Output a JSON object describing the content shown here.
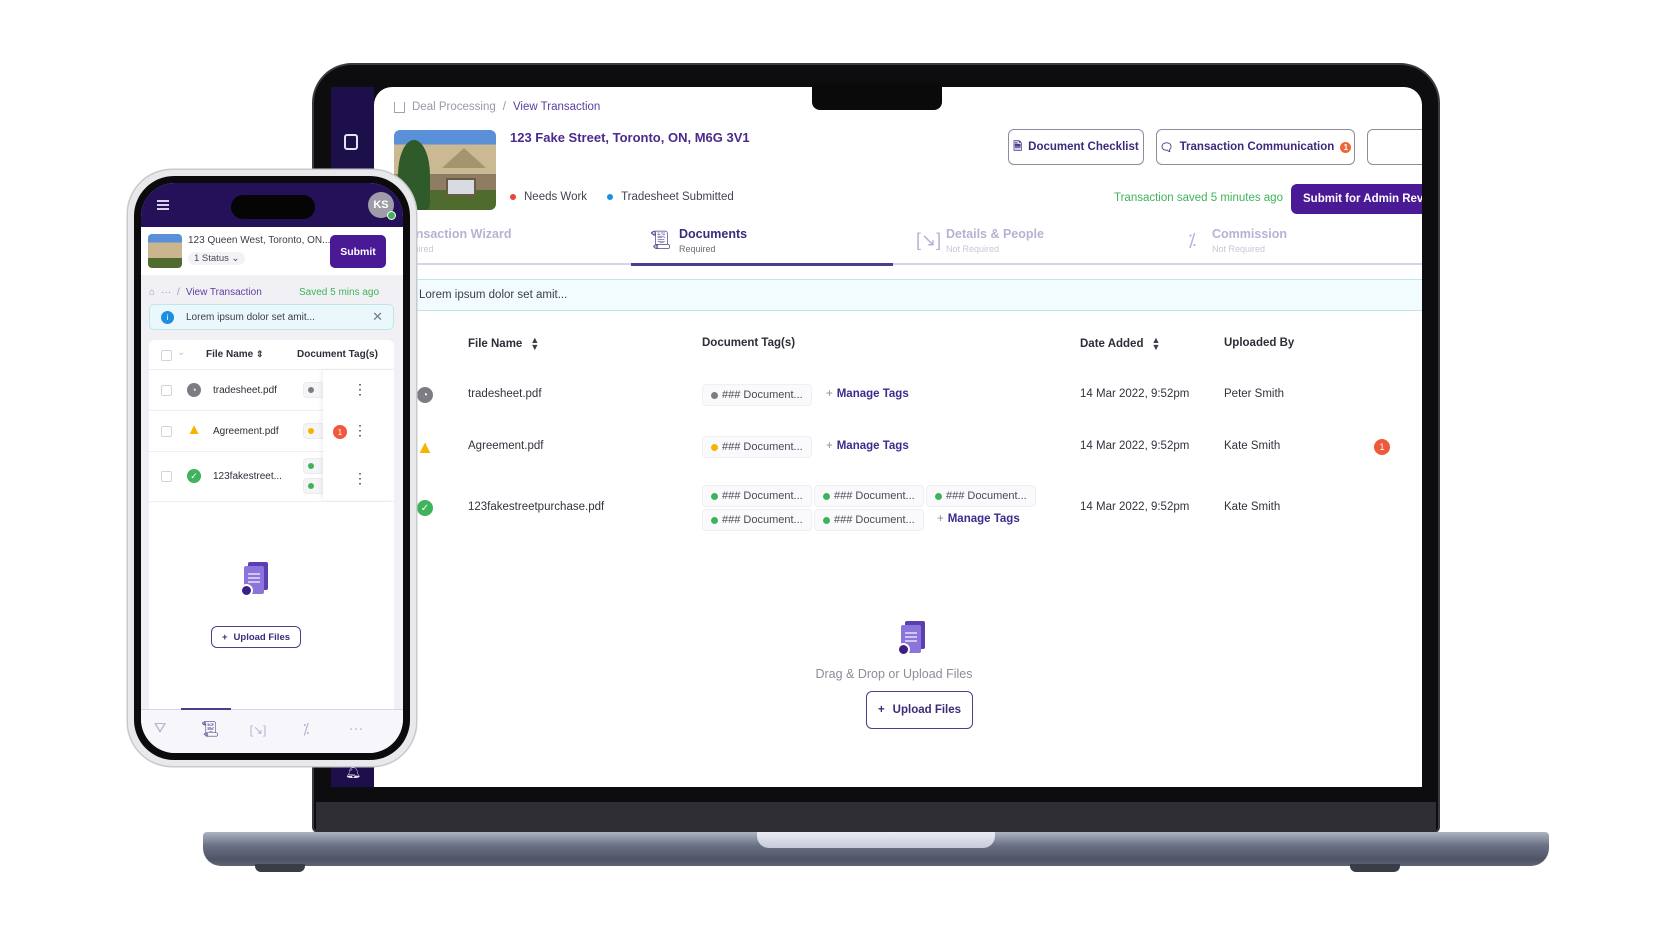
{
  "laptop": {
    "breadcrumb": {
      "items": [
        "Deal Processing",
        "View Transaction"
      ]
    },
    "property": {
      "address": "123 Fake Street, Toronto, ON, M6G 3V1",
      "statuses": [
        {
          "label": "Needs Work",
          "color": "#e8453c"
        },
        {
          "label": "Tradesheet Submitted",
          "color": "#1e8fe0"
        }
      ]
    },
    "header_buttons": {
      "document_checklist": "Document Checklist",
      "transaction_communication": "Transaction Communication",
      "communication_badge": "1"
    },
    "saved_status": "Transaction saved 5 minutes ago",
    "submit_button": "Submit for Admin Review",
    "tabs": [
      {
        "label": "Transaction Wizard",
        "sub": "Required",
        "icon": "wizard-icon"
      },
      {
        "label": "Documents",
        "sub": "Required",
        "icon": "documents-icon",
        "active": true
      },
      {
        "label": "Details & People",
        "sub": "Not Required",
        "icon": "details-icon"
      },
      {
        "label": "Commission",
        "sub": "Not Required",
        "icon": "percent-icon"
      }
    ],
    "alert": {
      "text": "Lorem ipsum dolor set amit..."
    },
    "table": {
      "columns": [
        "File Name",
        "Document Tag(s)",
        "Date Added",
        "Uploaded By"
      ],
      "manage_tags_label": "Manage Tags",
      "rows": [
        {
          "status": "pending",
          "file": "tradesheet.pdf",
          "tags": [
            "### Document..."
          ],
          "date": "14 Mar 2022, 9:52pm",
          "uploaded_by": "Peter Smith",
          "badge": ""
        },
        {
          "status": "warning",
          "file": "Agreement.pdf",
          "tags": [
            "### Document..."
          ],
          "date": "14 Mar 2022, 9:52pm",
          "uploaded_by": "Kate Smith",
          "badge": "1"
        },
        {
          "status": "approved",
          "file": "123fakestreetpurchase.pdf",
          "tags": [
            "### Document...",
            "### Document...",
            "### Document...",
            "### Document...",
            "### Document..."
          ],
          "date": "14 Mar 2022, 9:52pm",
          "uploaded_by": "Kate Smith",
          "badge": ""
        }
      ]
    },
    "dropzone": {
      "text": "Drag & Drop or Upload Files",
      "button": "Upload Files"
    }
  },
  "phone": {
    "avatar_initials": "KS",
    "property": {
      "address": "123 Queen West, Toronto, ON...",
      "status_dropdown": "1 Status"
    },
    "submit_button": "Submit",
    "breadcrumb": {
      "ellipsis": "···",
      "current": "View Transaction"
    },
    "saved_status": "Saved 5 mins ago",
    "alert": {
      "text": "Lorem ipsum dolor set amit..."
    },
    "table": {
      "columns": [
        "File Name",
        "Document Tag(s)"
      ],
      "rows": [
        {
          "status": "pending",
          "file": "tradesheet.pdf",
          "badge": ""
        },
        {
          "status": "warning",
          "file": "Agreement.pdf",
          "badge": "1"
        },
        {
          "status": "approved",
          "file": "123fakestreet...",
          "badge": ""
        }
      ]
    },
    "upload_button": "Upload Files",
    "bottom_nav": [
      "wizard-icon",
      "documents-icon",
      "details-icon",
      "percent-icon",
      "more-icon"
    ]
  },
  "colors": {
    "brand": "#4a1a96",
    "sidebar": "#1d0f4a",
    "success": "#3fb35a",
    "warning": "#f4b400",
    "pending": "#7d7c85",
    "badge": "#ee5a3a"
  }
}
